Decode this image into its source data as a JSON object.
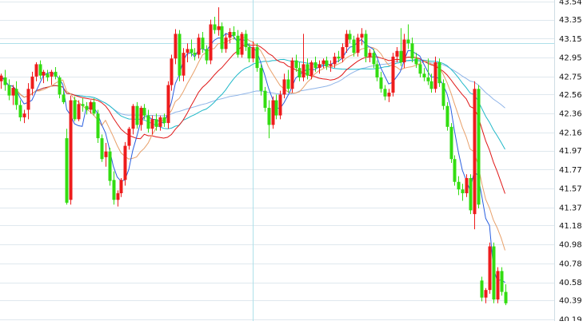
{
  "chart_data": {
    "type": "candlestick",
    "y_axis": {
      "position": "right",
      "ticks": [
        "43.54",
        "43.35",
        "43.15",
        "42.95",
        "42.75",
        "42.56",
        "42.36",
        "42.16",
        "41.97",
        "41.77",
        "41.57",
        "41.37",
        "41.18",
        "40.98",
        "40.78",
        "40.58",
        "40.39",
        "40.19"
      ],
      "ylim": [
        40.19,
        43.54
      ]
    },
    "grid": {
      "horizontal": true,
      "vertical": false
    },
    "crosshair": {
      "price": 43.1,
      "bar_index": 65
    },
    "colors": {
      "up": "#ee1c1c",
      "down": "#33dd11",
      "ma5": "#2a5fe0",
      "ma10": "#e8a06a",
      "ma20": "#e01818",
      "ma30": "#1fb8c8",
      "ma60": "#8fb4e8",
      "grid": "#dfe8ee",
      "crosshair": "#aee0ea",
      "axis": "#cfdde4"
    },
    "ohlc": [
      [
        42.7,
        42.78,
        42.62,
        42.76
      ],
      [
        42.74,
        42.82,
        42.6,
        42.66
      ],
      [
        42.66,
        42.72,
        42.5,
        42.55
      ],
      [
        42.55,
        42.66,
        42.45,
        42.63
      ],
      [
        42.62,
        42.7,
        42.4,
        42.45
      ],
      [
        42.45,
        42.5,
        42.28,
        42.32
      ],
      [
        42.32,
        42.4,
        42.26,
        42.36
      ],
      [
        42.4,
        42.68,
        42.3,
        42.62
      ],
      [
        42.62,
        42.8,
        42.55,
        42.75
      ],
      [
        42.75,
        42.9,
        42.7,
        42.88
      ],
      [
        42.88,
        42.92,
        42.72,
        42.76
      ],
      [
        42.76,
        42.82,
        42.68,
        42.8
      ],
      [
        42.78,
        42.82,
        42.7,
        42.74
      ],
      [
        42.75,
        42.82,
        42.66,
        42.8
      ],
      [
        42.8,
        42.85,
        42.72,
        42.75
      ],
      [
        42.74,
        42.76,
        42.52,
        42.56
      ],
      [
        42.56,
        42.6,
        42.46,
        42.48
      ],
      [
        42.1,
        42.2,
        41.4,
        41.42
      ],
      [
        41.45,
        42.55,
        41.4,
        42.5
      ],
      [
        42.5,
        42.54,
        42.28,
        42.3
      ],
      [
        42.3,
        42.5,
        42.28,
        42.46
      ],
      [
        42.46,
        42.52,
        42.38,
        42.44
      ],
      [
        42.44,
        42.48,
        42.35,
        42.4
      ],
      [
        42.4,
        42.5,
        42.36,
        42.48
      ],
      [
        42.48,
        42.52,
        42.34,
        42.36
      ],
      [
        42.36,
        42.4,
        42.05,
        42.1
      ],
      [
        42.1,
        42.14,
        41.85,
        41.88
      ],
      [
        41.9,
        42.05,
        41.8,
        41.96
      ],
      [
        41.96,
        42.0,
        41.6,
        41.65
      ],
      [
        41.66,
        41.75,
        41.4,
        41.45
      ],
      [
        41.45,
        41.55,
        41.38,
        41.52
      ],
      [
        41.52,
        41.68,
        41.48,
        41.66
      ],
      [
        41.66,
        42.06,
        41.6,
        42.02
      ],
      [
        42.02,
        42.22,
        41.98,
        42.2
      ],
      [
        42.2,
        42.46,
        42.14,
        42.44
      ],
      [
        42.44,
        42.48,
        42.2,
        42.24
      ],
      [
        42.24,
        42.44,
        42.18,
        42.42
      ],
      [
        42.42,
        42.46,
        42.3,
        42.34
      ],
      [
        42.34,
        42.4,
        42.16,
        42.2
      ],
      [
        42.2,
        42.34,
        42.14,
        42.3
      ],
      [
        42.3,
        42.36,
        42.18,
        42.22
      ],
      [
        42.22,
        42.34,
        42.18,
        42.32
      ],
      [
        42.32,
        42.36,
        42.22,
        42.26
      ],
      [
        42.26,
        42.7,
        42.2,
        42.66
      ],
      [
        42.66,
        42.98,
        42.6,
        42.94
      ],
      [
        42.94,
        43.25,
        42.88,
        43.2
      ],
      [
        43.2,
        43.24,
        42.7,
        42.76
      ],
      [
        42.76,
        43.05,
        42.7,
        43.0
      ],
      [
        43.0,
        43.1,
        42.9,
        43.04
      ],
      [
        43.04,
        43.14,
        42.96,
        43.0
      ],
      [
        43.0,
        43.05,
        42.92,
        42.98
      ],
      [
        42.98,
        43.2,
        42.94,
        43.16
      ],
      [
        43.16,
        43.22,
        43.0,
        43.04
      ],
      [
        43.04,
        43.08,
        42.88,
        42.92
      ],
      [
        42.92,
        43.35,
        42.88,
        43.3
      ],
      [
        43.3,
        43.38,
        43.2,
        43.24
      ],
      [
        43.24,
        43.48,
        43.18,
        43.28
      ],
      [
        43.28,
        43.32,
        43.0,
        43.04
      ],
      [
        43.04,
        43.2,
        43.0,
        43.16
      ],
      [
        43.16,
        43.26,
        43.1,
        43.22
      ],
      [
        43.22,
        43.28,
        43.14,
        43.18
      ],
      [
        43.18,
        43.24,
        42.95,
        42.98
      ],
      [
        42.98,
        43.22,
        42.95,
        43.2
      ],
      [
        43.2,
        43.24,
        43.02,
        43.06
      ],
      [
        43.06,
        43.1,
        42.9,
        42.94
      ],
      [
        42.94,
        43.12,
        42.9,
        43.06
      ],
      [
        43.06,
        43.1,
        42.8,
        42.84
      ],
      [
        42.84,
        42.88,
        42.55,
        42.6
      ],
      [
        42.6,
        42.64,
        42.38,
        42.42
      ],
      [
        42.42,
        42.5,
        42.1,
        42.24
      ],
      [
        42.24,
        42.54,
        42.2,
        42.5
      ],
      [
        42.5,
        42.56,
        42.3,
        42.34
      ],
      [
        42.34,
        42.6,
        42.3,
        42.56
      ],
      [
        42.56,
        42.78,
        42.52,
        42.72
      ],
      [
        42.72,
        42.82,
        42.58,
        42.62
      ],
      [
        42.62,
        42.95,
        42.58,
        42.92
      ],
      [
        42.92,
        42.98,
        42.8,
        42.84
      ],
      [
        42.84,
        42.9,
        42.7,
        42.74
      ],
      [
        42.74,
        43.2,
        42.7,
        42.88
      ],
      [
        42.88,
        42.94,
        42.72,
        42.76
      ],
      [
        42.76,
        42.92,
        42.72,
        42.9
      ],
      [
        42.9,
        42.96,
        42.8,
        42.84
      ],
      [
        42.84,
        42.92,
        42.78,
        42.88
      ],
      [
        42.88,
        42.94,
        42.84,
        42.92
      ],
      [
        42.92,
        42.96,
        42.82,
        42.86
      ],
      [
        42.86,
        42.92,
        42.8,
        42.88
      ],
      [
        42.88,
        43.0,
        42.84,
        42.96
      ],
      [
        42.96,
        43.02,
        42.9,
        42.94
      ],
      [
        42.94,
        43.1,
        42.9,
        43.06
      ],
      [
        43.06,
        43.24,
        43.0,
        43.2
      ],
      [
        43.2,
        43.24,
        43.1,
        43.14
      ],
      [
        43.14,
        43.18,
        42.96,
        43.0
      ],
      [
        43.0,
        43.2,
        42.96,
        43.16
      ],
      [
        43.16,
        43.26,
        43.08,
        43.2
      ],
      [
        43.2,
        43.24,
        42.9,
        42.96
      ],
      [
        42.96,
        43.04,
        42.9,
        43.0
      ],
      [
        43.0,
        43.04,
        42.84,
        42.88
      ],
      [
        42.88,
        42.92,
        42.7,
        42.74
      ],
      [
        42.74,
        42.8,
        42.58,
        42.62
      ],
      [
        42.62,
        42.66,
        42.5,
        42.54
      ],
      [
        42.54,
        42.62,
        42.48,
        42.58
      ],
      [
        42.58,
        43.0,
        42.54,
        42.96
      ],
      [
        42.96,
        43.06,
        42.9,
        43.02
      ],
      [
        43.02,
        43.26,
        42.86,
        42.9
      ],
      [
        42.9,
        43.2,
        42.84,
        43.14
      ],
      [
        43.14,
        43.3,
        43.04,
        43.1
      ],
      [
        43.1,
        43.16,
        42.9,
        42.94
      ],
      [
        42.94,
        43.0,
        42.84,
        42.88
      ],
      [
        42.88,
        42.92,
        42.74,
        42.78
      ],
      [
        42.78,
        42.84,
        42.7,
        42.74
      ],
      [
        42.74,
        42.94,
        42.66,
        42.7
      ],
      [
        42.7,
        42.78,
        42.58,
        42.62
      ],
      [
        42.62,
        42.96,
        42.58,
        42.9
      ],
      [
        42.9,
        42.94,
        42.64,
        42.68
      ],
      [
        42.68,
        42.72,
        42.4,
        42.44
      ],
      [
        42.44,
        42.48,
        42.18,
        42.22
      ],
      [
        42.22,
        42.26,
        41.84,
        41.88
      ],
      [
        41.88,
        41.92,
        41.6,
        41.64
      ],
      [
        41.64,
        41.7,
        41.5,
        41.56
      ],
      [
        41.56,
        41.62,
        41.44,
        41.52
      ],
      [
        41.52,
        41.72,
        41.48,
        41.68
      ],
      [
        41.68,
        41.72,
        41.3,
        41.34
      ],
      [
        41.3,
        42.7,
        41.14,
        42.62
      ],
      [
        42.62,
        42.66,
        41.36,
        41.4
      ],
      [
        40.6,
        40.64,
        40.38,
        40.42
      ],
      [
        40.42,
        40.52,
        40.36,
        40.5
      ],
      [
        40.5,
        41.0,
        40.46,
        40.96
      ],
      [
        40.96,
        41.0,
        40.36,
        40.4
      ],
      [
        40.4,
        40.74,
        40.36,
        40.7
      ],
      [
        40.7,
        40.74,
        40.44,
        40.48
      ],
      [
        40.48,
        40.56,
        40.34,
        40.36
      ]
    ]
  }
}
